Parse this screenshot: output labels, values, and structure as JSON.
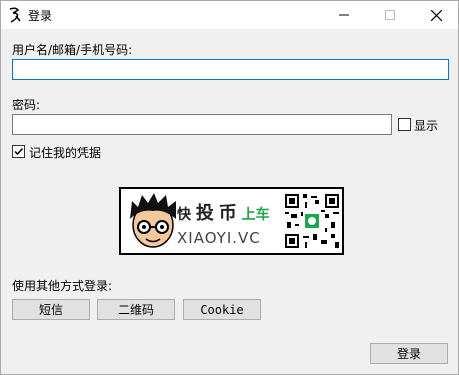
{
  "window": {
    "title": "登录"
  },
  "form": {
    "username_label": "用户名/邮箱/手机号码:",
    "username_value": "",
    "password_label": "密码:",
    "password_value": "",
    "show_label": "显示",
    "remember_label": "记住我的凭据",
    "remember_checked": true,
    "show_checked": false
  },
  "promo": {
    "text_kuai": "快",
    "text_tou": "投",
    "text_bi": "币",
    "text_shangche": "上车",
    "domain": "XIAOYI.VC"
  },
  "other_login": {
    "label": "使用其他方式登录:",
    "sms": "短信",
    "qrcode": "二维码",
    "cookie": "Cookie"
  },
  "login_button": "登录",
  "colors": {
    "focus": "#0078d7",
    "green": "#1aa84a",
    "dark": "#222222"
  }
}
